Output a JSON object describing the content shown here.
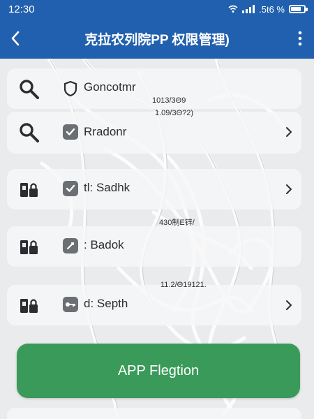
{
  "status_bar": {
    "time": "12:30",
    "battery_text": ".5t6 %"
  },
  "app_bar": {
    "title": "克拉农列院PP 权限管理)"
  },
  "rows": [
    {
      "label": "Goncotmr",
      "meta": "1013/3Θ9",
      "meta2": "1.09/3Θ?2)",
      "icon": "search-icon",
      "sub_icon": "shield-icon",
      "chevron": false
    },
    {
      "label": "Rradonr",
      "icon": "search-icon",
      "sub_icon": "check-icon",
      "chevron": true
    },
    {
      "label": "tl: Sadhk",
      "icon": "device-lock-icon",
      "sub_icon": "check-icon",
      "chevron": true
    },
    {
      "label": ": Badok",
      "meta": "430制E锌/",
      "icon": "device-lock-icon",
      "sub_icon": "edit-icon",
      "chevron": false
    },
    {
      "label": "d: Septh",
      "meta": "11.2/Θ19121.",
      "icon": "device-lock-icon",
      "sub_icon": "key-icon",
      "chevron": true
    }
  ],
  "primary_button": {
    "label": "APP Flegtion"
  },
  "colors": {
    "header": "#2160ae",
    "button": "#3a9a59",
    "icon": "#2b2d30"
  }
}
